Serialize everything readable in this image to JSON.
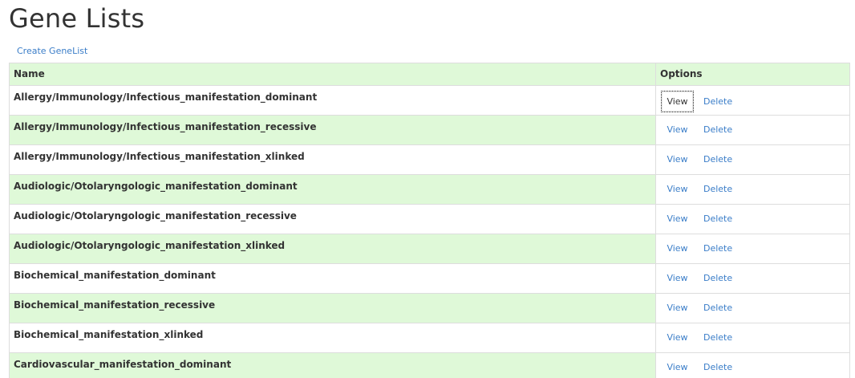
{
  "page": {
    "title": "Gene Lists",
    "create_link": "Create GeneList"
  },
  "table": {
    "headers": {
      "name": "Name",
      "options": "Options"
    },
    "view_label": "View",
    "delete_label": "Delete",
    "rows": [
      {
        "name": "Allergy/Immunology/Infectious_manifestation_dominant",
        "focused": true
      },
      {
        "name": "Allergy/Immunology/Infectious_manifestation_recessive"
      },
      {
        "name": "Allergy/Immunology/Infectious_manifestation_xlinked"
      },
      {
        "name": "Audiologic/Otolaryngologic_manifestation_dominant"
      },
      {
        "name": "Audiologic/Otolaryngologic_manifestation_recessive"
      },
      {
        "name": "Audiologic/Otolaryngologic_manifestation_xlinked"
      },
      {
        "name": "Biochemical_manifestation_dominant"
      },
      {
        "name": "Biochemical_manifestation_recessive"
      },
      {
        "name": "Biochemical_manifestation_xlinked"
      },
      {
        "name": "Cardiovascular_manifestation_dominant"
      }
    ]
  },
  "colors": {
    "row_highlight": "#dff9d8",
    "link": "#3a7dc8",
    "text": "#333333",
    "border": "#dddddd"
  }
}
